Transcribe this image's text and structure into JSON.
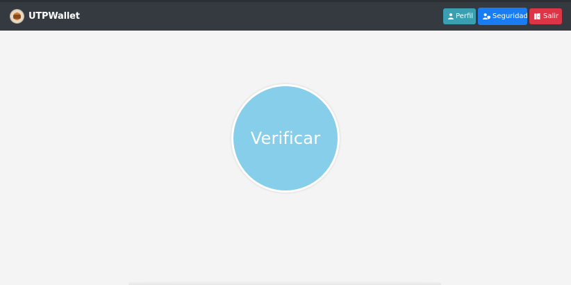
{
  "navbar": {
    "brand": "UTPWallet",
    "buttons": {
      "perfil": "Perfil",
      "seguridad": "Seguridad",
      "salir": "Salir"
    }
  },
  "main": {
    "verify_label": "Verificar"
  },
  "icons": {
    "logo": "wallet-logo-icon",
    "perfil": "user-icon",
    "seguridad": "user-shield-icon",
    "salir": "door-exit-icon"
  },
  "colors": {
    "navbar": "#343a40",
    "background": "#f4f4f4",
    "perfil_button": "#3a9fb0",
    "seguridad_button": "#1a7cf2",
    "salir_button": "#dc3545",
    "verify_circle": "#87ceeb"
  }
}
